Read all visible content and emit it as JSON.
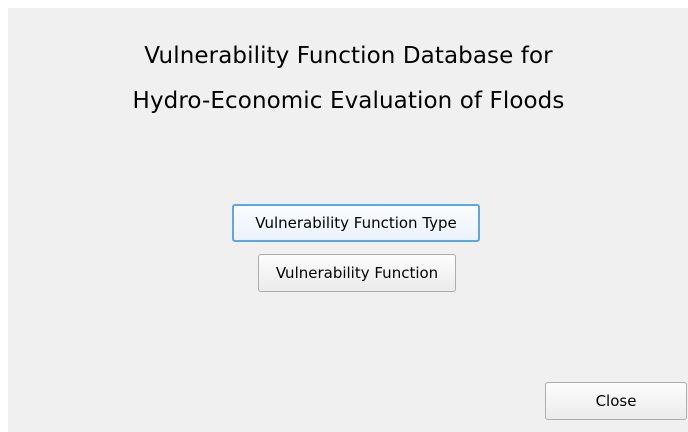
{
  "window": {
    "title_line1": "Vulnerability Function Database for",
    "title_line2": "Hydro-Economic Evaluation of Floods"
  },
  "buttons": {
    "vulnerability_function_type": "Vulnerability Function Type",
    "vulnerability_function": "Vulnerability Function",
    "close": "Close"
  },
  "colors": {
    "dialog_background": "#f0f0f0",
    "focus_border": "#5aa7ea",
    "button_border": "#adadad"
  }
}
